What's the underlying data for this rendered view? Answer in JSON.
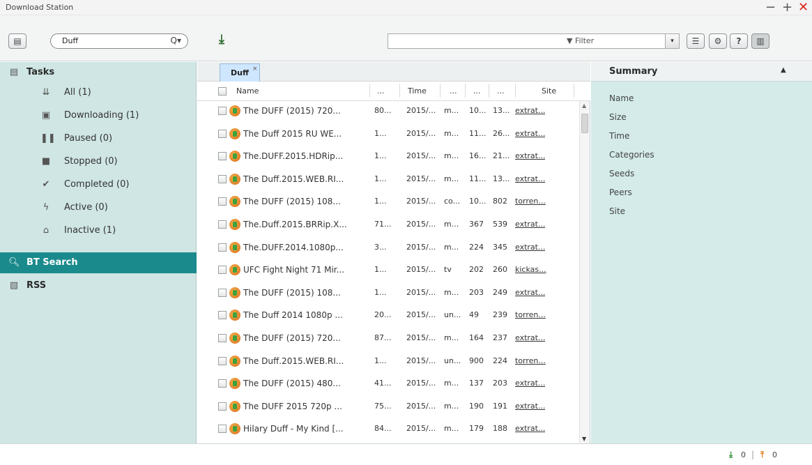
{
  "window": {
    "title": "Download Station",
    "min": "−",
    "max": "+",
    "close": "✕"
  },
  "toolbar": {
    "search_value": "Duff",
    "search_icon": "Q▾",
    "download_icon": "⤓",
    "filter_label": "▼ Filter",
    "filter_arrow": "▾",
    "help": "?"
  },
  "sidebar": {
    "tasks_label": "Tasks",
    "items": [
      {
        "label": "All (1)",
        "icon": "all-tasks-icon",
        "glyph": "⇊"
      },
      {
        "label": "Downloading (1)",
        "icon": "downloading-icon",
        "glyph": "▣"
      },
      {
        "label": "Paused (0)",
        "icon": "paused-icon",
        "glyph": "❚❚"
      },
      {
        "label": "Stopped (0)",
        "icon": "stopped-icon",
        "glyph": "■"
      },
      {
        "label": "Completed (0)",
        "icon": "completed-icon",
        "glyph": "✔"
      },
      {
        "label": "Active (0)",
        "icon": "active-icon",
        "glyph": "ϟ"
      },
      {
        "label": "Inactive (1)",
        "icon": "inactive-icon",
        "glyph": "⌂"
      }
    ],
    "bt_search_label": "BT Search",
    "rss_label": "RSS"
  },
  "main": {
    "tab_label": "Duff",
    "tab_close": "×",
    "columns": {
      "name": "Name",
      "c2": "...",
      "time": "Time",
      "c4": "...",
      "c5": "...",
      "c6": "...",
      "site": "Site"
    },
    "rows": [
      {
        "name": "The DUFF (2015) 720...",
        "size": "80...",
        "time": "2015/...",
        "cat": "m...",
        "seeds": "10...",
        "peers": "13...",
        "site": "extrat..."
      },
      {
        "name": "The Duff 2015 RU WE...",
        "size": "1...",
        "time": "2015/...",
        "cat": "m...",
        "seeds": "11...",
        "peers": "26...",
        "site": "extrat..."
      },
      {
        "name": "The.DUFF.2015.HDRip...",
        "size": "1...",
        "time": "2015/...",
        "cat": "m...",
        "seeds": "16...",
        "peers": "21...",
        "site": "extrat..."
      },
      {
        "name": "The Duff.2015.WEB.RI...",
        "size": "1...",
        "time": "2015/...",
        "cat": "m...",
        "seeds": "11...",
        "peers": "13...",
        "site": "extrat..."
      },
      {
        "name": "The DUFF (2015) 108...",
        "size": "1...",
        "time": "2015/...",
        "cat": "co...",
        "seeds": "10...",
        "peers": "802",
        "site": "torren..."
      },
      {
        "name": "The.Duff.2015.BRRip.X...",
        "size": "71...",
        "time": "2015/...",
        "cat": "m...",
        "seeds": "367",
        "peers": "539",
        "site": "extrat..."
      },
      {
        "name": "The.DUFF.2014.1080p...",
        "size": "3...",
        "time": "2015/...",
        "cat": "m...",
        "seeds": "224",
        "peers": "345",
        "site": "extrat..."
      },
      {
        "name": "UFC Fight Night 71 Mir...",
        "size": "1...",
        "time": "2015/...",
        "cat": "tv",
        "seeds": "202",
        "peers": "260",
        "site": "kickas..."
      },
      {
        "name": "The DUFF (2015) 108...",
        "size": "1...",
        "time": "2015/...",
        "cat": "m...",
        "seeds": "203",
        "peers": "249",
        "site": "extrat..."
      },
      {
        "name": "The Duff 2014 1080p ...",
        "size": "20...",
        "time": "2015/...",
        "cat": "un...",
        "seeds": "49",
        "peers": "239",
        "site": "torren..."
      },
      {
        "name": "The DUFF (2015) 720...",
        "size": "87...",
        "time": "2015/...",
        "cat": "m...",
        "seeds": "164",
        "peers": "237",
        "site": "extrat..."
      },
      {
        "name": "The Duff.2015.WEB.RI...",
        "size": "1...",
        "time": "2015/...",
        "cat": "un...",
        "seeds": "900",
        "peers": "224",
        "site": "torren..."
      },
      {
        "name": "The DUFF (2015) 480...",
        "size": "41...",
        "time": "2015/...",
        "cat": "m...",
        "seeds": "137",
        "peers": "203",
        "site": "extrat..."
      },
      {
        "name": "The DUFF 2015 720p ...",
        "size": "75...",
        "time": "2015/...",
        "cat": "m...",
        "seeds": "190",
        "peers": "191",
        "site": "extrat..."
      },
      {
        "name": "Hilary Duff - My Kind [...",
        "size": "84...",
        "time": "2015/...",
        "cat": "m...",
        "seeds": "179",
        "peers": "188",
        "site": "extrat..."
      }
    ]
  },
  "summary": {
    "title": "Summary",
    "collapse": "▲",
    "fields": [
      "Name",
      "Size",
      "Time",
      "Categories",
      "Seeds",
      "Peers",
      "Site"
    ]
  },
  "status": {
    "download_count": "0",
    "upload_count": "0",
    "separator": "|",
    "download_glyph": "⤓",
    "upload_glyph": "⤒"
  },
  "colors": {
    "sidebar_bg": "#cfe6e4",
    "active_bg": "#1a8a8c",
    "summary_bg": "#d4ebe9",
    "tab_bg": "#cfe6ff",
    "close_red": "#d9261c"
  }
}
